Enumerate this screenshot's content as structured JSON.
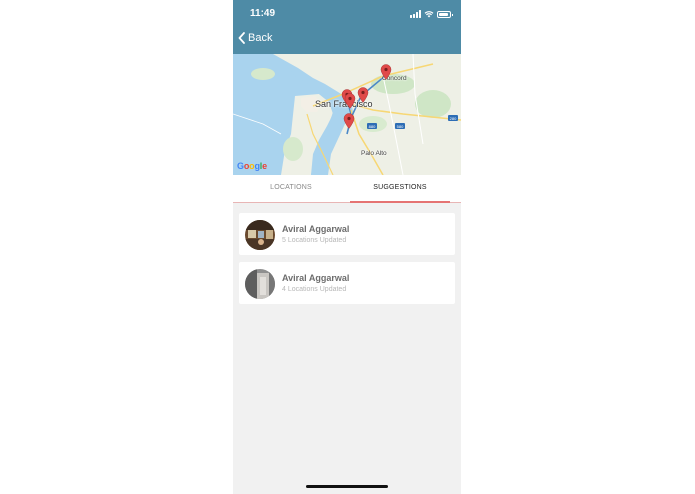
{
  "status_bar": {
    "time": "11:49"
  },
  "nav": {
    "back_label": "Back"
  },
  "map": {
    "labels": {
      "concord": "Concord",
      "san_francisco": "San Francisco",
      "palo_alto": "Palo Alto"
    },
    "highway_shields": [
      "880",
      "580",
      "280"
    ],
    "attribution": "Google",
    "pin_color": "#e04a4a"
  },
  "tabs": [
    {
      "label": "LOCATIONS",
      "active": false
    },
    {
      "label": "SUGGESTIONS",
      "active": true
    }
  ],
  "suggestions": [
    {
      "name": "Aviral Aggarwal",
      "subtitle": "5 Locations Updated"
    },
    {
      "name": "Aviral Aggarwal",
      "subtitle": "4 Locations Updated"
    }
  ],
  "colors": {
    "header": "#4e8ba6",
    "tab_underline": "#e57373",
    "background": "#f1f1f1"
  }
}
